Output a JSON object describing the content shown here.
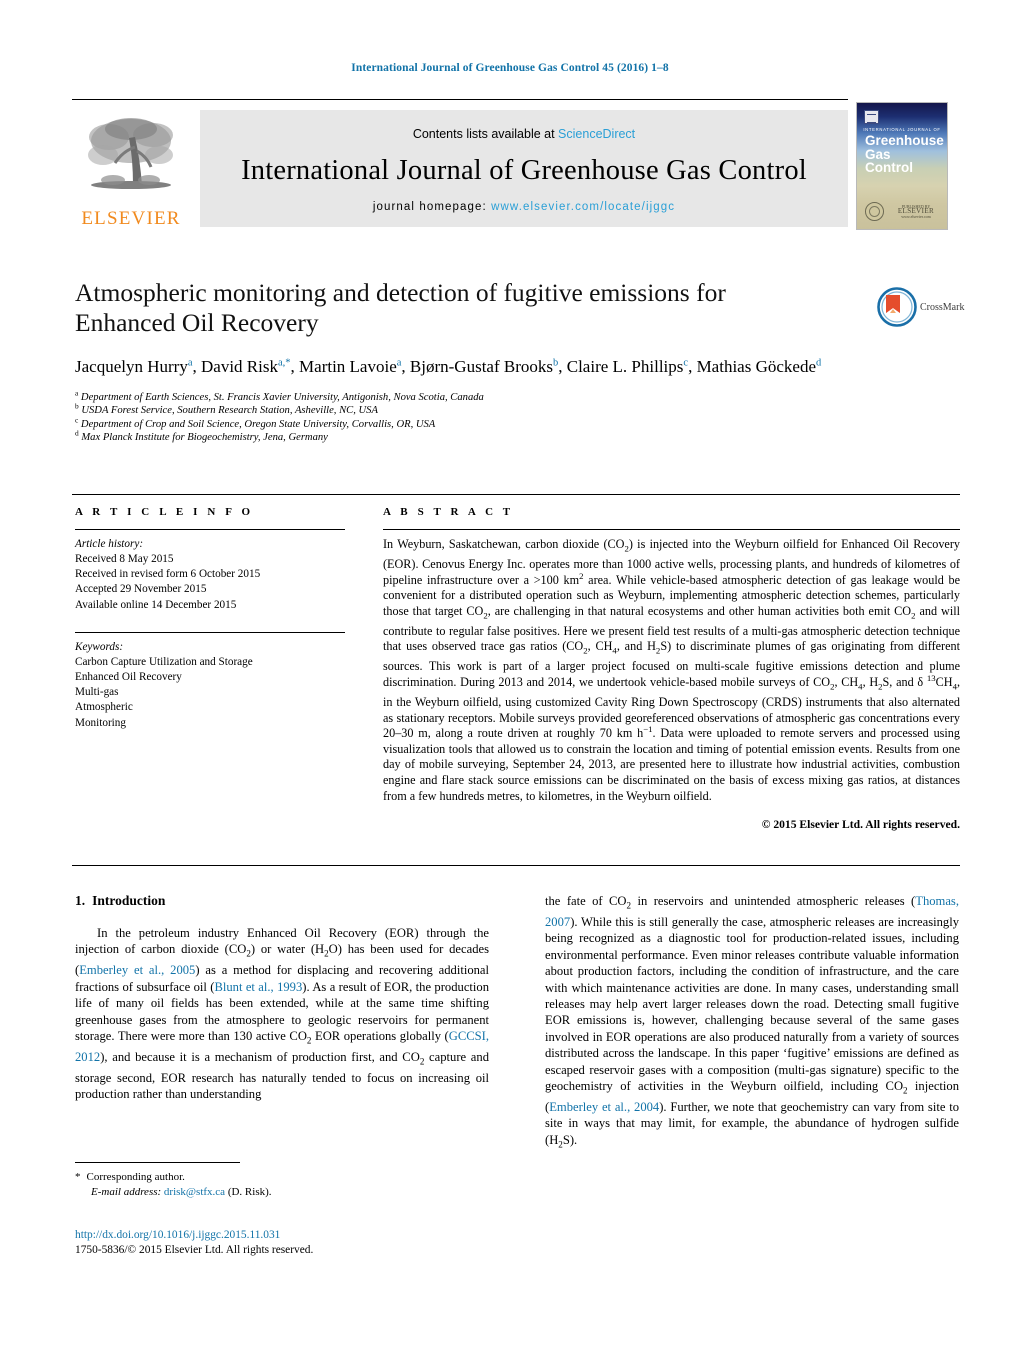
{
  "running_head": "International Journal of Greenhouse Gas Control 45 (2016) 1–8",
  "masthead": {
    "contents_prefix": "Contents lists available at ",
    "contents_link": "ScienceDirect",
    "journal_title": "International Journal of Greenhouse Gas Control",
    "homepage_prefix": "journal homepage: ",
    "homepage_url": "www.elsevier.com/locate/ijggc",
    "publisher": "ELSEVIER",
    "link_color": "#2a9fd6",
    "elsevier_orange": "#f18a1e"
  },
  "cover": {
    "superline": "INTERNATIONAL JOURNAL OF",
    "line1": "Greenhouse",
    "line2": "Gas Control",
    "publisher_small": "PUBLISHED BY",
    "publisher_big": "ELSEVIER",
    "publisher_sub": "www.elsevier.com"
  },
  "article": {
    "title": "Atmospheric monitoring and detection of fugitive emissions for Enhanced Oil Recovery",
    "crossmark_label": "CrossMark",
    "authors": [
      {
        "name": "Jacquelyn Hurry",
        "marks": "a",
        "sep": ", "
      },
      {
        "name": "David Risk",
        "marks": "a,*",
        "sep": ", "
      },
      {
        "name": "Martin Lavoie",
        "marks": "a",
        "sep": ", "
      },
      {
        "name": "Bjørn-Gustaf Brooks",
        "marks": "b",
        "sep": ", "
      },
      {
        "name": "Claire L. Phillips",
        "marks": "c",
        "sep": ", "
      },
      {
        "name": "Mathias Göckede",
        "marks": "d",
        "sep": ""
      }
    ],
    "affiliations": [
      {
        "mark": "a",
        "text": "Department of Earth Sciences, St. Francis Xavier University, Antigonish, Nova Scotia, Canada"
      },
      {
        "mark": "b",
        "text": "USDA Forest Service, Southern Research Station, Asheville, NC, USA"
      },
      {
        "mark": "c",
        "text": "Department of Crop and Soil Science, Oregon State University, Corvallis, OR, USA"
      },
      {
        "mark": "d",
        "text": "Max Planck Institute for Biogeochemistry, Jena, Germany"
      }
    ]
  },
  "article_info": {
    "heading": "A R T I C L E   I N F O",
    "history_label": "Article history:",
    "history": [
      "Received 8 May 2015",
      "Received in revised form 6 October 2015",
      "Accepted 29 November 2015",
      "Available online 14 December 2015"
    ],
    "keywords_label": "Keywords:",
    "keywords": [
      "Carbon Capture Utilization and Storage",
      "Enhanced Oil Recovery",
      "Multi-gas",
      "Atmospheric",
      "Monitoring"
    ]
  },
  "abstract": {
    "heading": "A B S T R A C T",
    "copyright": "© 2015 Elsevier Ltd. All rights reserved."
  },
  "intro": {
    "number": "1.",
    "heading": "Introduction"
  },
  "footnote": {
    "star": "*",
    "corresponding": "Corresponding author.",
    "email_label": "E-mail address:",
    "email": "drisk@stfx.ca",
    "email_suffix": "(D. Risk)."
  },
  "bottom": {
    "doi": "http://dx.doi.org/10.1016/j.ijggc.2015.11.031",
    "issn_line": "1750-5836/© 2015 Elsevier Ltd. All rights reserved."
  }
}
